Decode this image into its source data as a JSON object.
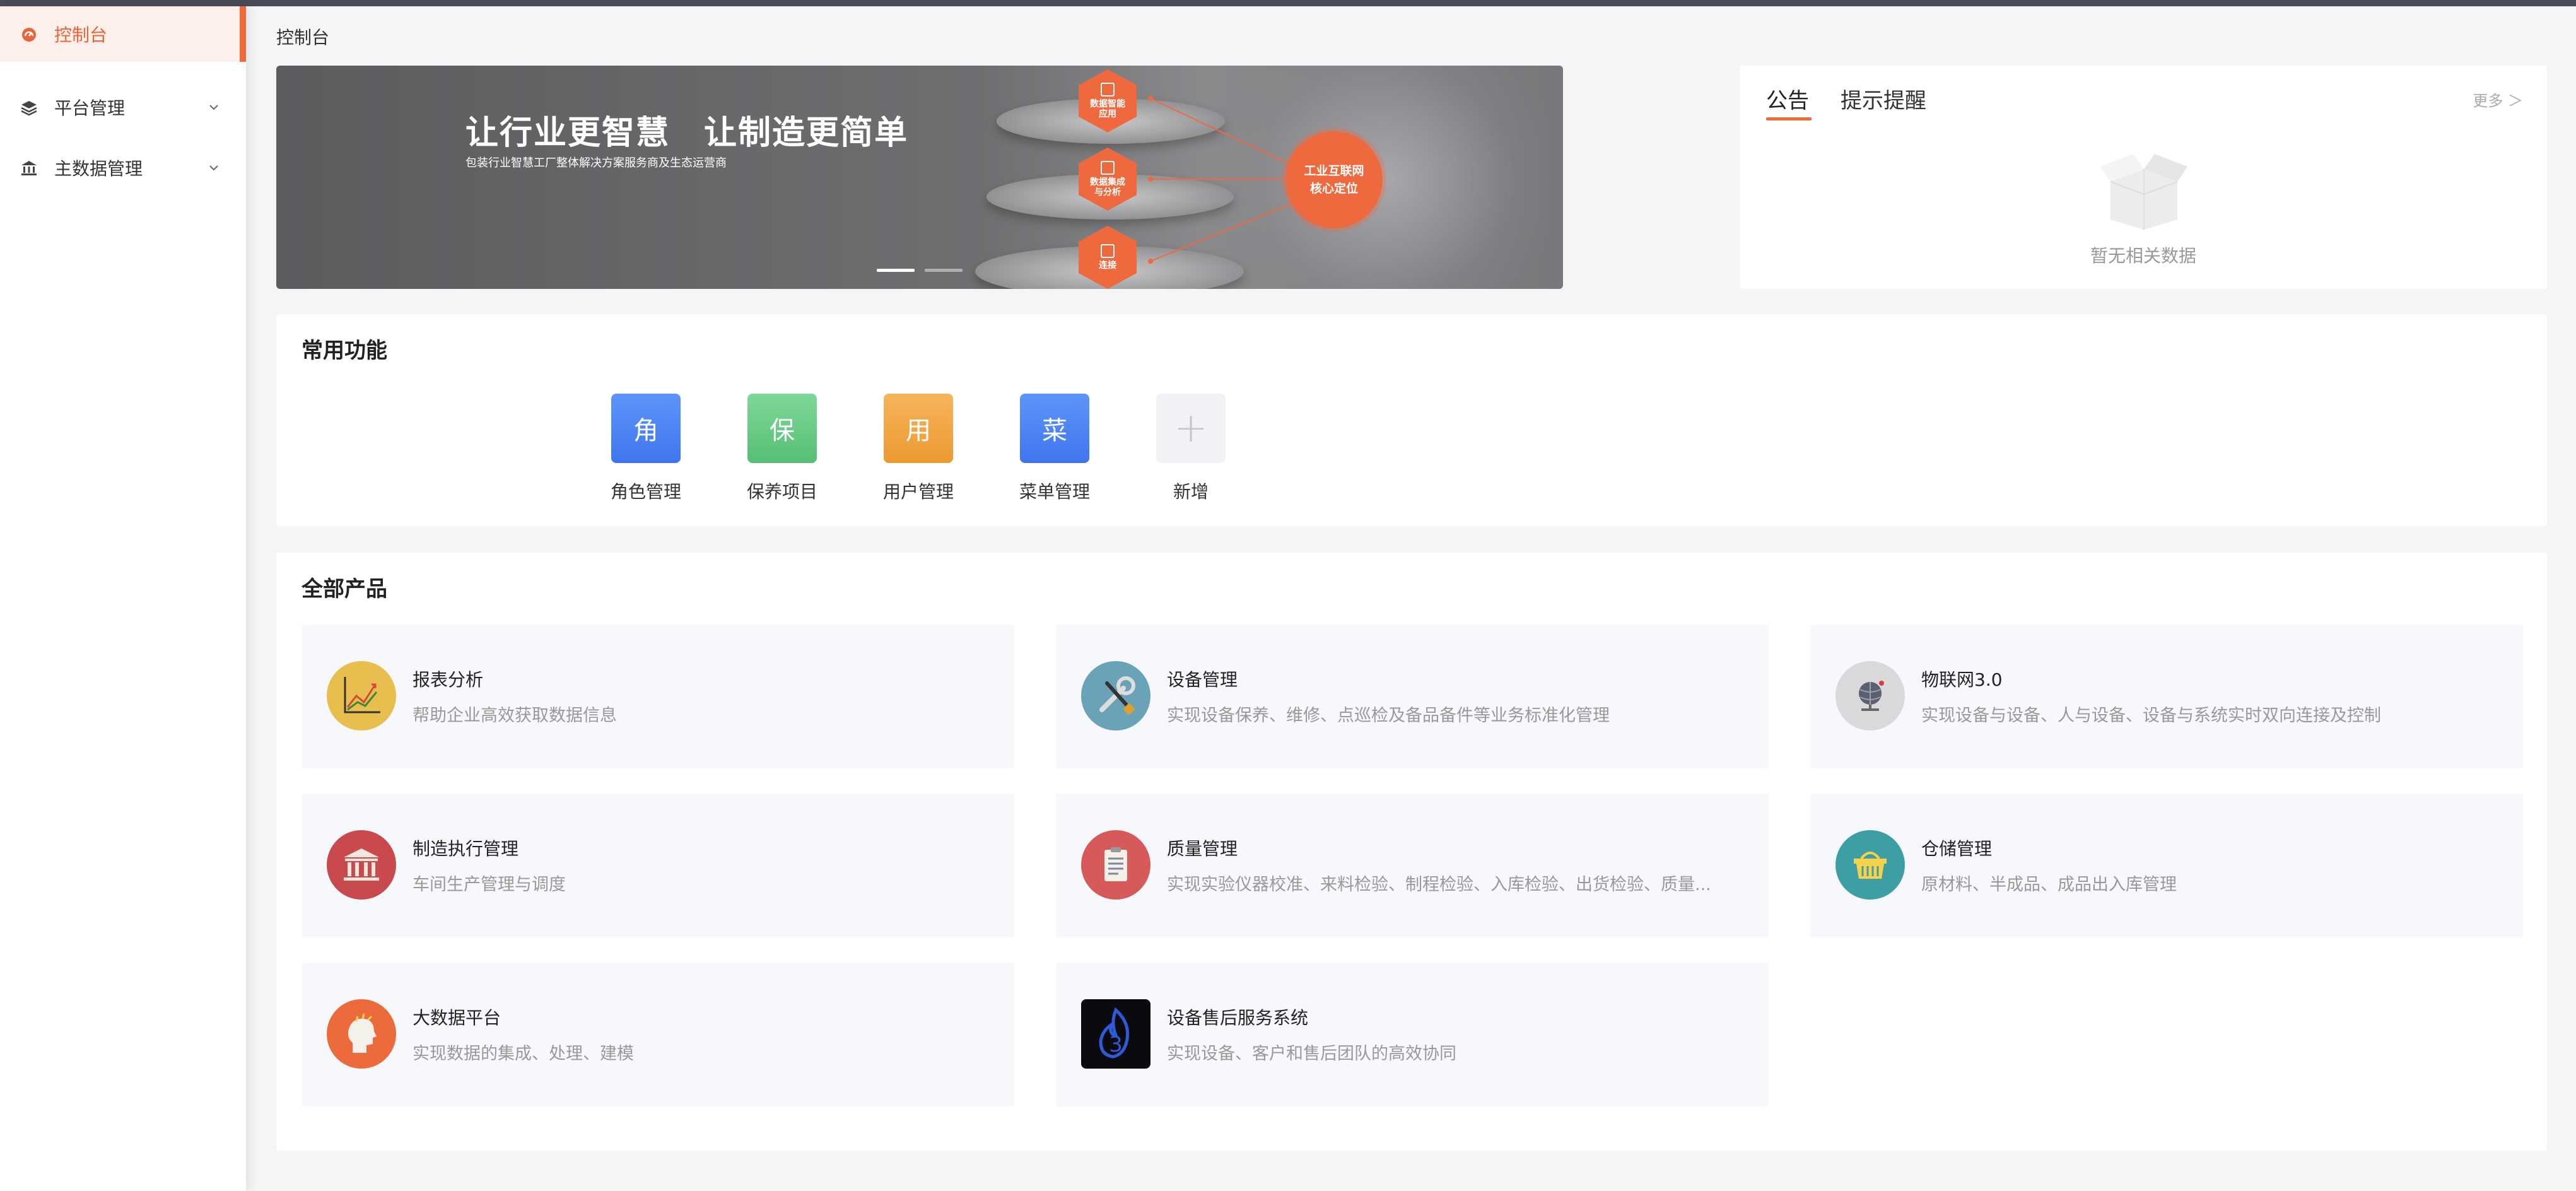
{
  "sidebar": {
    "items": [
      {
        "label": "控制台",
        "icon": "dashboard-icon"
      },
      {
        "label": "平台管理",
        "icon": "layers-icon"
      },
      {
        "label": "主数据管理",
        "icon": "bank-icon"
      }
    ]
  },
  "breadcrumb": "控制台",
  "banner": {
    "title": "让行业更智慧　让制造更简单",
    "subtitle": "包装行业智慧工厂整体解决方案服务商及生态运营商",
    "nodes": [
      "数据智能应用",
      "数据集成与分析",
      "连接"
    ],
    "core": "工业互联网核心定位",
    "slides": 2,
    "active_slide": 1
  },
  "notice": {
    "tabs": [
      "公告",
      "提示提醒"
    ],
    "more": "更多 ＞",
    "empty": "暂无相关数据"
  },
  "common": {
    "title": "常用功能",
    "items": [
      {
        "char": "角",
        "label": "角色管理",
        "color": "#4a86f7"
      },
      {
        "char": "保",
        "label": "保养项目",
        "color": "#5fc77d"
      },
      {
        "char": "用",
        "label": "用户管理",
        "color": "#f0a03c"
      },
      {
        "char": "菜",
        "label": "菜单管理",
        "color": "#4a86f7"
      },
      {
        "char": "+",
        "label": "新增",
        "color": "#f1f2f5"
      }
    ]
  },
  "products": {
    "title": "全部产品",
    "items": [
      {
        "name": "报表分析",
        "desc": "帮助企业高效获取数据信息",
        "icon": "chart-icon",
        "color": "#e8be4e"
      },
      {
        "name": "设备管理",
        "desc": "实现设备保养、维修、点巡检及备品备件等业务标准化管理",
        "icon": "tools-icon",
        "color": "#6aa2b8"
      },
      {
        "name": "物联网3.0",
        "desc": "实现设备与设备、人与设备、设备与系统实时双向连接及控制",
        "icon": "globe-icon",
        "color": "#d9d9db"
      },
      {
        "name": "制造执行管理",
        "desc": "车间生产管理与调度",
        "icon": "building-icon",
        "color": "#c94a4e"
      },
      {
        "name": "质量管理",
        "desc": "实现实验仪器校准、来料检验、制程检验、入库检验、出货检验、质量...",
        "icon": "clipboard-icon",
        "color": "#d65a5a"
      },
      {
        "name": "仓储管理",
        "desc": "原材料、半成品、成品出入库管理",
        "icon": "basket-icon",
        "color": "#3d9ea4"
      },
      {
        "name": "大数据平台",
        "desc": "实现数据的集成、处理、建模",
        "icon": "head-icon",
        "color": "#ec6a3c"
      },
      {
        "name": "设备售后服务系统",
        "desc": "实现设备、客户和售后团队的高效协同",
        "icon": "flame-3-icon",
        "color": "#0a0a0f"
      }
    ]
  },
  "colors": {
    "accent": "#ec6a3c"
  }
}
